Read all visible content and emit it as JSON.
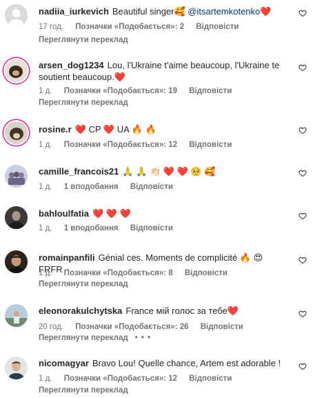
{
  "colors": {
    "text": "#262626",
    "secondary": "#737373",
    "mention": "#00376b",
    "story_ring": "#d6249f"
  },
  "comments": [
    {
      "username": "nadiia_iurkevich",
      "text": "Beautiful singer🥰",
      "mention": "@itsartemkotenko",
      "text_end": "❤️",
      "time": "17 год.",
      "likes": "Позначки «Подобається»: 2",
      "reply": "Відповісти",
      "translate": "Переглянути переклад",
      "avatar": "default-avatar"
    },
    {
      "username": "arsen_dog1234",
      "text": "Lou, l'Ukraine t'aime beaucoup, l'Ukraine te soutient beaucoup.❤️",
      "time": "1 д.",
      "likes": "Позначки «Подобається»: 19",
      "reply": "Відповісти",
      "translate": "Переглянути переклад",
      "avatar": "dog-avatar"
    },
    {
      "username": "rosine.r",
      "text": "❤️ CP ❤️ UA 🔥 🔥",
      "time": "1 д.",
      "likes": "Позначки «Подобається»: 12",
      "reply": "Відповісти",
      "avatar": "dog-avatar"
    },
    {
      "username": "camille_francois21",
      "text": "🙏 🙏 👏🏻 ❤️ ❤️ 🥺 🥰",
      "time": "1 д.",
      "likes": "1 вподобання",
      "reply": "Відповісти",
      "avatar": "group-avatar"
    },
    {
      "username": "bahloulfatia",
      "text": "❤️ ❤️ ❤️",
      "time": "1 д.",
      "likes": "1 вподобання",
      "reply": "Відповісти",
      "avatar": "portrait-avatar"
    },
    {
      "username": "romainpanfili",
      "text": "Génial ces. Moments de complicité 🔥 😍 FRFR",
      "time": "1 д.",
      "likes": "Позначки «Подобається»: 8",
      "reply": "Відповісти",
      "translate": "Переглянути переклад",
      "avatar": "portrait-avatar"
    },
    {
      "username": "eleonorakulchytska",
      "text": "France мій голос за тебе❤️",
      "time": "20 год.",
      "likes": "Позначки «Подобається»: 26",
      "reply": "Відповісти",
      "translate": "Переглянути переклад",
      "more": "• • •",
      "avatar": "outdoor-avatar"
    },
    {
      "username": "nicomagyar",
      "text": "Bravo Lou! Quelle chance, Artem est adorable !",
      "time": "1 д.",
      "likes": "Позначки «Подобається»: 12",
      "reply": "Відповісти",
      "translate": "Переглянути переклад",
      "avatar": "portrait-avatar"
    }
  ]
}
